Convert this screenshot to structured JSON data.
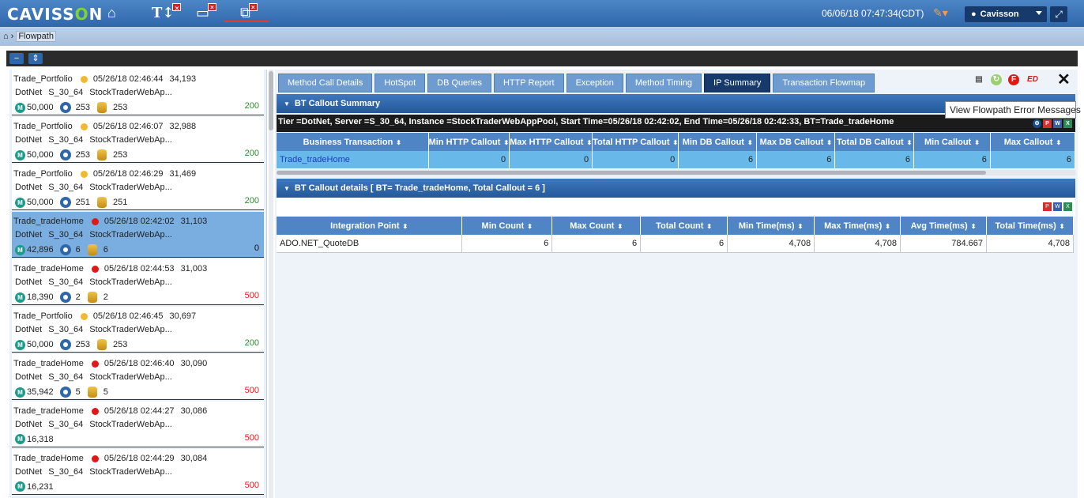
{
  "app": {
    "logo_pre": "CAVISS",
    "logo_o": "O",
    "logo_post": "N",
    "datetime": "06/06/18 07:47:34(CDT)",
    "user": "Cavisson"
  },
  "breadcrumb": {
    "label": "Flowpath"
  },
  "flowpaths": [
    {
      "bt": "Trade_Portfolio",
      "status_color": "yellow",
      "time": "05/26/18 02:46:44",
      "id": "34,193",
      "tier": "DotNet",
      "server": "S_30_64",
      "instance": "StockTraderWebAp...",
      "resp": "50,000",
      "net": "253",
      "db": "253",
      "code": "200",
      "code_type": "ok",
      "selected": false
    },
    {
      "bt": "Trade_Portfolio",
      "status_color": "yellow",
      "time": "05/26/18 02:46:07",
      "id": "32,988",
      "tier": "DotNet",
      "server": "S_30_64",
      "instance": "StockTraderWebAp...",
      "resp": "50,000",
      "net": "253",
      "db": "253",
      "code": "200",
      "code_type": "ok",
      "selected": false
    },
    {
      "bt": "Trade_Portfolio",
      "status_color": "yellow",
      "time": "05/26/18 02:46:29",
      "id": "31,469",
      "tier": "DotNet",
      "server": "S_30_64",
      "instance": "StockTraderWebAp...",
      "resp": "50,000",
      "net": "251",
      "db": "251",
      "code": "200",
      "code_type": "ok",
      "selected": false
    },
    {
      "bt": "Trade_tradeHome",
      "status_color": "red",
      "time": "05/26/18 02:42:02",
      "id": "31,103",
      "tier": "DotNet",
      "server": "S_30_64",
      "instance": "StockTraderWebAp...",
      "resp": "42,896",
      "net": "6",
      "db": "6",
      "code": "0",
      "code_type": "zero",
      "selected": true
    },
    {
      "bt": "Trade_tradeHome",
      "status_color": "red",
      "time": "05/26/18 02:44:53",
      "id": "31,003",
      "tier": "DotNet",
      "server": "S_30_64",
      "instance": "StockTraderWebAp...",
      "resp": "18,390",
      "net": "2",
      "db": "2",
      "code": "500",
      "code_type": "err",
      "selected": false
    },
    {
      "bt": "Trade_Portfolio",
      "status_color": "yellow",
      "time": "05/26/18 02:46:45",
      "id": "30,697",
      "tier": "DotNet",
      "server": "S_30_64",
      "instance": "StockTraderWebAp...",
      "resp": "50,000",
      "net": "253",
      "db": "253",
      "code": "200",
      "code_type": "ok",
      "selected": false
    },
    {
      "bt": "Trade_tradeHome",
      "status_color": "red",
      "time": "05/26/18 02:46:40",
      "id": "30,090",
      "tier": "DotNet",
      "server": "S_30_64",
      "instance": "StockTraderWebAp...",
      "resp": "35,942",
      "net": "5",
      "db": "5",
      "code": "500",
      "code_type": "err",
      "selected": false
    },
    {
      "bt": "Trade_tradeHome",
      "status_color": "red",
      "time": "05/26/18 02:44:27",
      "id": "30,086",
      "tier": "DotNet",
      "server": "S_30_64",
      "instance": "StockTraderWebAp...",
      "resp": "16,318",
      "net": null,
      "db": null,
      "code": "500",
      "code_type": "err",
      "selected": false
    },
    {
      "bt": "Trade_tradeHome",
      "status_color": "red",
      "time": "05/26/18 02:44:29",
      "id": "30,084",
      "tier": "DotNet",
      "server": "S_30_64",
      "instance": "StockTraderWebAp...",
      "resp": "16,231",
      "net": null,
      "db": null,
      "code": "500",
      "code_type": "err",
      "selected": false
    }
  ],
  "tabs": [
    {
      "label": "Method Call Details",
      "active": false
    },
    {
      "label": "HotSpot",
      "active": false
    },
    {
      "label": "DB Queries",
      "active": false
    },
    {
      "label": "HTTP Report",
      "active": false
    },
    {
      "label": "Exception",
      "active": false
    },
    {
      "label": "Method Timing",
      "active": false
    },
    {
      "label": "IP Summary",
      "active": true
    },
    {
      "label": "Transaction Flowmap",
      "active": false
    }
  ],
  "tooltip": "View Flowpath Error Messages",
  "summary": {
    "title": "BT Callout Summary",
    "info": "Tier =DotNet, Server =S_30_64, Instance =StockTraderWebAppPool, Start Time=05/26/18 02:42:02, End Time=05/26/18 02:42:33, BT=Trade_tradeHome",
    "columns": [
      "Business Transaction",
      "Min HTTP Callout",
      "Max HTTP Callout",
      "Total HTTP Callout",
      "Min DB Callout",
      "Max DB Callout",
      "Total DB Callout",
      "Min Callout",
      "Max Callout"
    ],
    "rows": [
      [
        "Trade_tradeHome",
        "0",
        "0",
        "0",
        "6",
        "6",
        "6",
        "6",
        "6"
      ]
    ]
  },
  "details": {
    "title": "BT Callout details [ BT= Trade_tradeHome, Total Callout = 6 ]",
    "columns": [
      "Integration Point",
      "Min Count",
      "Max Count",
      "Total Count",
      "Min Time(ms)",
      "Max Time(ms)",
      "Avg Time(ms)",
      "Total Time(ms)"
    ],
    "rows": [
      [
        "ADO.NET_QuoteDB",
        "6",
        "6",
        "6",
        "4,708",
        "4,708",
        "784.667",
        "4,708"
      ]
    ]
  }
}
